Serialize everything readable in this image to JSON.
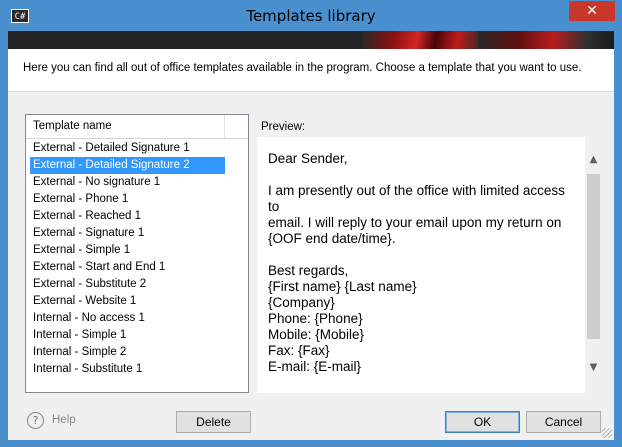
{
  "window": {
    "title": "Templates library",
    "app_icon": "c#-icon",
    "close_glyph": "✕"
  },
  "description": "Here you can find all out of office templates available in the program. Choose a template that you want to use.",
  "list": {
    "header": "Template name",
    "selected_index": 1,
    "items": [
      "External - Detailed Signature 1",
      "External - Detailed Signature 2",
      "External - No signature 1",
      "External - Phone 1",
      "External - Reached 1",
      "External - Signature 1",
      "External - Simple 1",
      "External - Start and End 1",
      "External - Substitute 2",
      "External - Website 1",
      "Internal - No access 1",
      "Internal - Simple 1",
      "Internal - Simple 2",
      "Internal - Substitute 1"
    ]
  },
  "preview": {
    "label": "Preview:",
    "lines": [
      "Dear Sender,",
      "",
      "I am presently out of the office with limited access to",
      "email. I will reply to your email upon my return on",
      "{OOF end date/time}.",
      "",
      "Best regards,",
      "{First name} {Last name}",
      "{Company}",
      "Phone: {Phone}",
      "Mobile: {Mobile}",
      "Fax: {Fax}",
      "E-mail: {E-mail}"
    ]
  },
  "footer": {
    "help_label": "Help",
    "delete_label": "Delete",
    "ok_label": "OK",
    "cancel_label": "Cancel"
  },
  "colors": {
    "title_bar": "#4a8fce",
    "selection": "#3399ff",
    "close_button": "#c7382b"
  }
}
